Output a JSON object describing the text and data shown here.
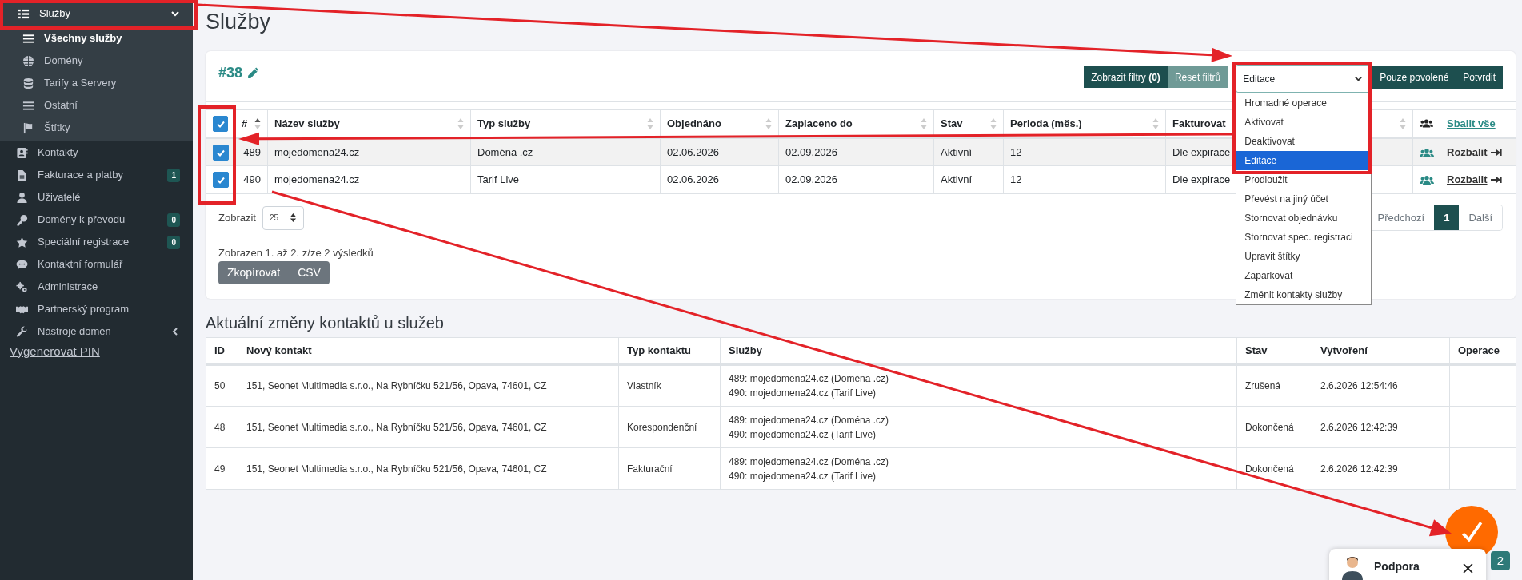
{
  "sidebar": {
    "items": [
      {
        "kind": "group",
        "label": "Služby",
        "expanded": true,
        "children": [
          {
            "label": "Všechny služby",
            "selected": true
          },
          {
            "label": "Domény",
            "selected": false
          },
          {
            "label": "Tarify a Servery",
            "selected": false
          },
          {
            "label": "Ostatní",
            "selected": false
          },
          {
            "label": "Štítky",
            "selected": false
          }
        ]
      },
      {
        "kind": "link",
        "label": "Kontakty"
      },
      {
        "kind": "link",
        "label": "Fakturace a platby",
        "badge": "1"
      },
      {
        "kind": "link",
        "label": "Uživatelé"
      },
      {
        "kind": "link",
        "label": "Domény k převodu",
        "badge": "0"
      },
      {
        "kind": "link",
        "label": "Speciální registrace",
        "badge": "0"
      },
      {
        "kind": "link",
        "label": "Kontaktní formulář"
      },
      {
        "kind": "link",
        "label": "Administrace"
      },
      {
        "kind": "link",
        "label": "Partnerský program"
      },
      {
        "kind": "group",
        "label": "Nástroje domén",
        "expanded": false
      }
    ],
    "footer_link": "Vygenerovat PIN"
  },
  "page_title": "Služby",
  "services": {
    "title": "#38",
    "filter_buttons": [
      "Zobrazit filtry **(0)**",
      "Reset filtrů"
    ],
    "bulk_action": {
      "value": "Editace",
      "open": true,
      "options": [
        {
          "label": "Hromadné operace",
          "selected": false
        },
        {
          "label": "Aktivovat",
          "selected": false
        },
        {
          "label": "Deaktivovat",
          "selected": false
        },
        {
          "label": "Editace",
          "selected": true
        },
        {
          "label": "Prodloužit",
          "selected": false
        },
        {
          "label": "Převést na jiný účet",
          "selected": false
        },
        {
          "label": "Stornovat objednávku",
          "selected": false
        },
        {
          "label": "Stornovat spec. registraci",
          "selected": false
        },
        {
          "label": "Upravit štítky",
          "selected": false
        },
        {
          "label": "Zaparkovat",
          "selected": false
        },
        {
          "label": "Změnit kontakty služby",
          "selected": false
        }
      ]
    },
    "action_buttons": [
      "Pouze povolené",
      "Potvrdit"
    ],
    "table": {
      "select_all": {
        "checked": true
      },
      "columns": [
        {
          "kind": "text",
          "label": "#",
          "sorted": true
        },
        {
          "kind": "text",
          "label": "Název služby",
          "sorted": false
        },
        {
          "kind": "text",
          "label": "Typ služby",
          "sorted": false
        },
        {
          "kind": "text",
          "label": "Objednáno",
          "sorted": false
        },
        {
          "kind": "text",
          "label": "Zaplaceno do",
          "sorted": false
        },
        {
          "kind": "text",
          "label": "Stav",
          "sorted": false
        },
        {
          "kind": "text",
          "label": "Perioda (měs.)",
          "sorted": false
        },
        {
          "kind": "text",
          "label": "Fakturovat"
        },
        {
          "kind": "sort_only",
          "sorted": false
        },
        {
          "kind": "icon"
        },
        {
          "kind": "link",
          "label": "Sbalit vše"
        }
      ],
      "rows": [
        {
          "checked": true,
          "hovered": true,
          "cells": [
            "489",
            "mojedomena24.cz",
            "Doména .cz",
            "02.06.2026",
            "02.09.2026",
            "Aktivní",
            "12",
            "Dle expirace"
          ],
          "action": "Rozbalit"
        },
        {
          "checked": true,
          "hovered": false,
          "cells": [
            "490",
            "mojedomena24.cz",
            "Tarif Live",
            "02.06.2026",
            "02.09.2026",
            "Aktivní",
            "12",
            "Dle expirace"
          ],
          "action": "Rozbalit"
        }
      ]
    },
    "page_size": {
      "label": "Zobrazit",
      "value": "25"
    },
    "info": "Zobrazen 1. až 2. z/ze 2 výsledků",
    "export_buttons": [
      "Zkopírovat",
      "CSV"
    ],
    "pagination": [
      {
        "label": "Předchozí",
        "selected": false
      },
      {
        "label": "1",
        "selected": true
      },
      {
        "label": "Další",
        "selected": false
      }
    ]
  },
  "contact_changes": {
    "title": "Aktuální změny kontaktů u služeb",
    "columns": [
      "ID",
      "Nový kontakt",
      "Typ kontaktu",
      "Služby",
      "Stav",
      "Vytvoření",
      "Operace"
    ],
    "rows": [
      {
        "id": "50",
        "contact": "151, Seonet Multimedia s.r.o., Na Rybníčku 521/56, Opava, 74601, CZ",
        "type": "Vlastník",
        "services": [
          "489: mojedomena24.cz (Doména .cz)",
          "490: mojedomena24.cz (Tarif Live)"
        ],
        "status": "Zrušená",
        "created": "2.6.2026 12:54:46"
      },
      {
        "id": "48",
        "contact": "151, Seonet Multimedia s.r.o., Na Rybníčku 521/56, Opava, 74601, CZ",
        "type": "Korespondenční",
        "services": [
          "489: mojedomena24.cz (Doména .cz)",
          "490: mojedomena24.cz (Tarif Live)"
        ],
        "status": "Dokončená",
        "created": "2.6.2026 12:42:39"
      },
      {
        "id": "49",
        "contact": "151, Seonet Multimedia s.r.o., Na Rybníčku 521/56, Opava, 74601, CZ",
        "type": "Fakturační",
        "services": [
          "489: mojedomena24.cz (Doména .cz)",
          "490: mojedomena24.cz (Tarif Live)"
        ],
        "status": "Dokončená",
        "created": "2.6.2026 12:42:39"
      }
    ]
  },
  "chat": {
    "title": "Podpora",
    "badge": "2"
  }
}
